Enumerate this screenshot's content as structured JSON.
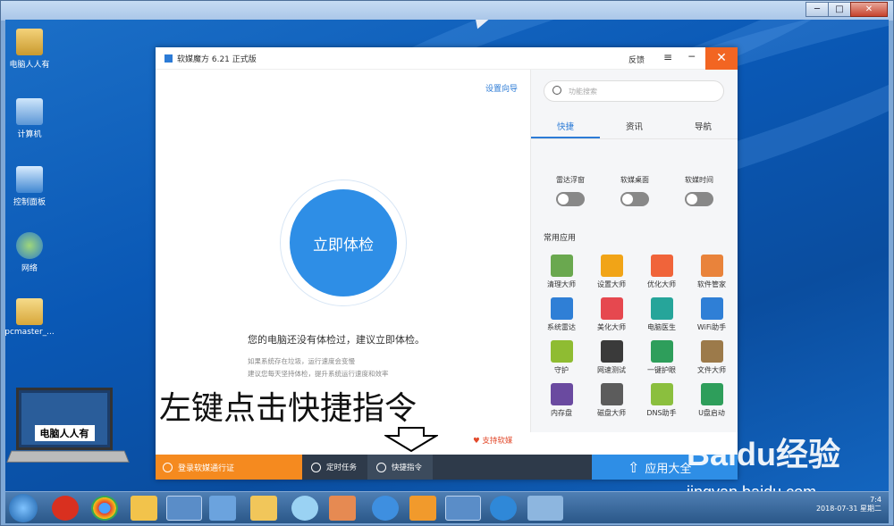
{
  "window": {
    "minimize": "─",
    "maximize": "□",
    "close": "✕"
  },
  "desktop": {
    "icons": [
      {
        "label": "电脑人人有"
      },
      {
        "label": "计算机"
      },
      {
        "label": "控制面板"
      },
      {
        "label": "网络"
      },
      {
        "label": "pcmaster_..."
      }
    ],
    "laptop_brand": "电脑人人有"
  },
  "app": {
    "title": "软媒魔方 6.21 正式版",
    "feedback": "反馈",
    "menu": "≡",
    "minimize": "─",
    "close": "✕",
    "wizard": "设置向导",
    "check_button": "立即体检",
    "msg_main": "您的电脑还没有体检过，建议立即体检。",
    "msg_sub1": "如果系统存在垃圾，运行速度会变慢",
    "msg_sub2": "建议您每天坚持体检，提升系统运行速度和效率",
    "support": "♥ 支持软媒",
    "search_placeholder": "功能搜索",
    "tabs": [
      "快捷",
      "资讯",
      "导航"
    ],
    "toggles": [
      "雷达浮窗",
      "软媒桌面",
      "软媒时间"
    ],
    "apps_title": "常用应用",
    "apps": [
      {
        "label": "清理大师",
        "color": "#6aa84f"
      },
      {
        "label": "设置大师",
        "color": "#f1a417"
      },
      {
        "label": "优化大师",
        "color": "#f0643a"
      },
      {
        "label": "软件管家",
        "color": "#e9833b"
      },
      {
        "label": "系统雷达",
        "color": "#2f7fd6"
      },
      {
        "label": "美化大师",
        "color": "#e6484f"
      },
      {
        "label": "电脑医生",
        "color": "#26a59a"
      },
      {
        "label": "WiFi助手",
        "color": "#2f7fd6"
      },
      {
        "label": "守护",
        "color": "#8fbc32"
      },
      {
        "label": "网速测试",
        "color": "#3a3a3a"
      },
      {
        "label": "一键护眼",
        "color": "#2e9e5b"
      },
      {
        "label": "文件大师",
        "color": "#9c7a4a"
      },
      {
        "label": "内存盘",
        "color": "#6a4aa0"
      },
      {
        "label": "磁盘大师",
        "color": "#5c5c5c"
      },
      {
        "label": "DNS助手",
        "color": "#8bbf3e"
      },
      {
        "label": "U盘启动",
        "color": "#2e9e5b"
      }
    ],
    "bottom": {
      "login": "登录软媒通行证",
      "scheduled": "定时任务",
      "shortcut": "快捷指令",
      "apps": "应用大全"
    }
  },
  "annotation": "左键点击快捷指令",
  "watermark": {
    "logo": "Baidu经验",
    "url": "jingyan.baidu.com"
  },
  "tray": {
    "time": "7:4",
    "date": "2018-07-31 星期二"
  }
}
